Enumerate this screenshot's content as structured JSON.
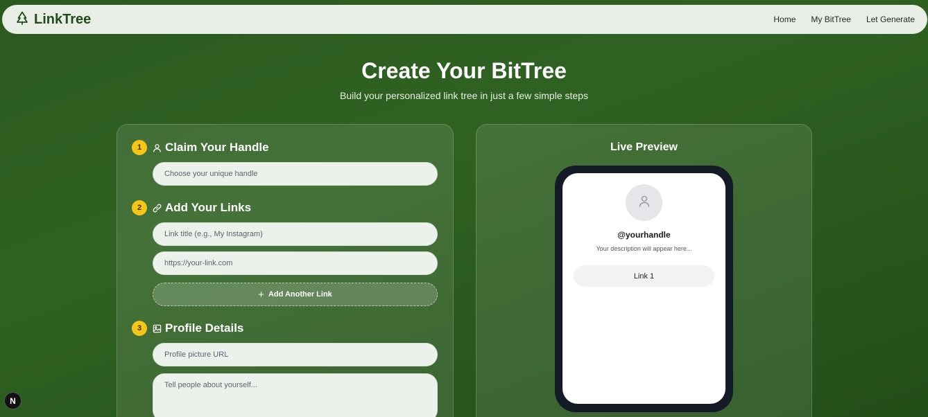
{
  "navbar": {
    "brand": "LinkTree",
    "brand_icon": "tree-icon",
    "links": [
      "Home",
      "My BitTree",
      "Let Generate"
    ]
  },
  "hero": {
    "title": "Create Your BitTree",
    "subtitle": "Build your personalized link tree in just a few simple steps"
  },
  "steps": [
    {
      "number": "1",
      "icon": "user-icon",
      "title": "Claim Your Handle",
      "handle_placeholder": "Choose your unique handle"
    },
    {
      "number": "2",
      "icon": "link-icon",
      "title": "Add Your Links",
      "link_title_placeholder": "Link title (e.g., My Instagram)",
      "link_url_placeholder": "https://your-link.com",
      "add_button": "Add Another Link"
    },
    {
      "number": "3",
      "icon": "image-icon",
      "title": "Profile Details",
      "pic_placeholder": "Profile picture URL",
      "bio_placeholder": "Tell people about yourself..."
    }
  ],
  "preview": {
    "title": "Live Preview",
    "handle": "@yourhandle",
    "description": "Your description will appear here...",
    "links": [
      "Link 1"
    ]
  },
  "badge": "N",
  "colors": {
    "background": "#2b5a1f",
    "accent": "#f5c518",
    "navbar": "#e8ede6",
    "phone_frame": "#141a26"
  }
}
